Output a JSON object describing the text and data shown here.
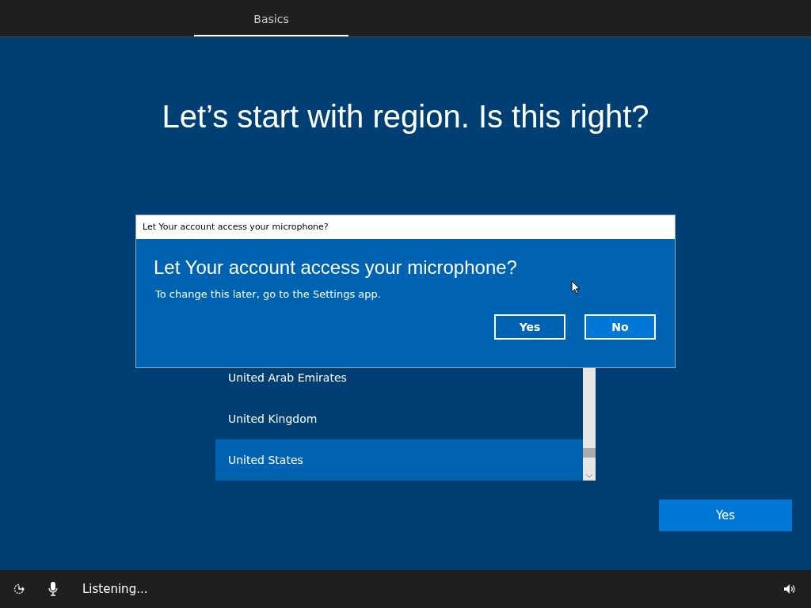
{
  "tabs": [
    {
      "label": "Basics",
      "selected": true
    }
  ],
  "heading": "Let’s start with region. Is this right?",
  "regions": [
    {
      "name": "United Arab Emirates",
      "selected": false
    },
    {
      "name": "United Kingdom",
      "selected": false
    },
    {
      "name": "United States",
      "selected": true
    }
  ],
  "primary_button": "Yes",
  "dialog": {
    "title": "Let Your account access your microphone?",
    "heading": "Let Your account access your microphone?",
    "message": "To change this later, go to the Settings app.",
    "buttons": [
      {
        "label": "Yes",
        "focused": false
      },
      {
        "label": "No",
        "focused": true
      }
    ]
  },
  "status_bar": {
    "text": "Listening..."
  }
}
